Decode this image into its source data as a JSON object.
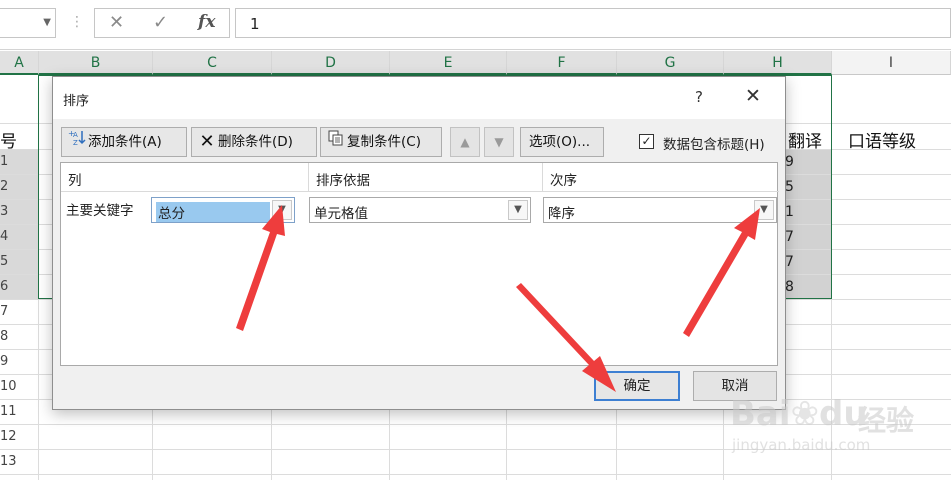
{
  "formula_bar": {
    "cancel_glyph": "✕",
    "enter_glyph": "✓",
    "fx_label": "fx",
    "value": "1"
  },
  "sheet": {
    "columns": [
      "A",
      "B",
      "C",
      "D",
      "E",
      "F",
      "G",
      "H",
      "I"
    ],
    "visible_header_cells": {
      "col_A": "号",
      "col_H": "翻译",
      "col_I": "口语等级"
    },
    "row_numbers": [
      "1",
      "2",
      "3",
      "4",
      "5",
      "6",
      "7",
      "8",
      "9",
      "10",
      "11",
      "12",
      "13"
    ],
    "col_H_partial_values": [
      "9",
      "5",
      "1",
      "7",
      "7",
      "8"
    ]
  },
  "dialog": {
    "title": "排序",
    "help_glyph": "?",
    "close_glyph": "✕",
    "toolbar": {
      "add_label": "添加条件(A)",
      "delete_label": "删除条件(D)",
      "copy_label": "复制条件(C)",
      "move_up_glyph": "▲",
      "move_down_glyph": "▼",
      "options_label": "选项(O)..."
    },
    "header_checkbox": {
      "label": "数据包含标题(H)",
      "checked": true,
      "glyph": "✓"
    },
    "columns": {
      "column": "列",
      "sort_on": "排序依据",
      "order": "次序"
    },
    "rows": [
      {
        "label": "主要关键字",
        "column_value": "总分",
        "sort_on_value": "单元格值",
        "order_value": "降序"
      }
    ],
    "ok_label": "确定",
    "cancel_label": "取消"
  },
  "annotations": {
    "arrow_color": "#ee3d3d"
  },
  "watermark": {
    "brand": "Bai",
    "brand_suffix": "du",
    "cn": "经验",
    "url": "jingyan.baidu.com"
  },
  "colors": {
    "excel_green": "#217346",
    "selection_gray": "#d9d9d9",
    "ok_border": "#3d7fd2"
  }
}
